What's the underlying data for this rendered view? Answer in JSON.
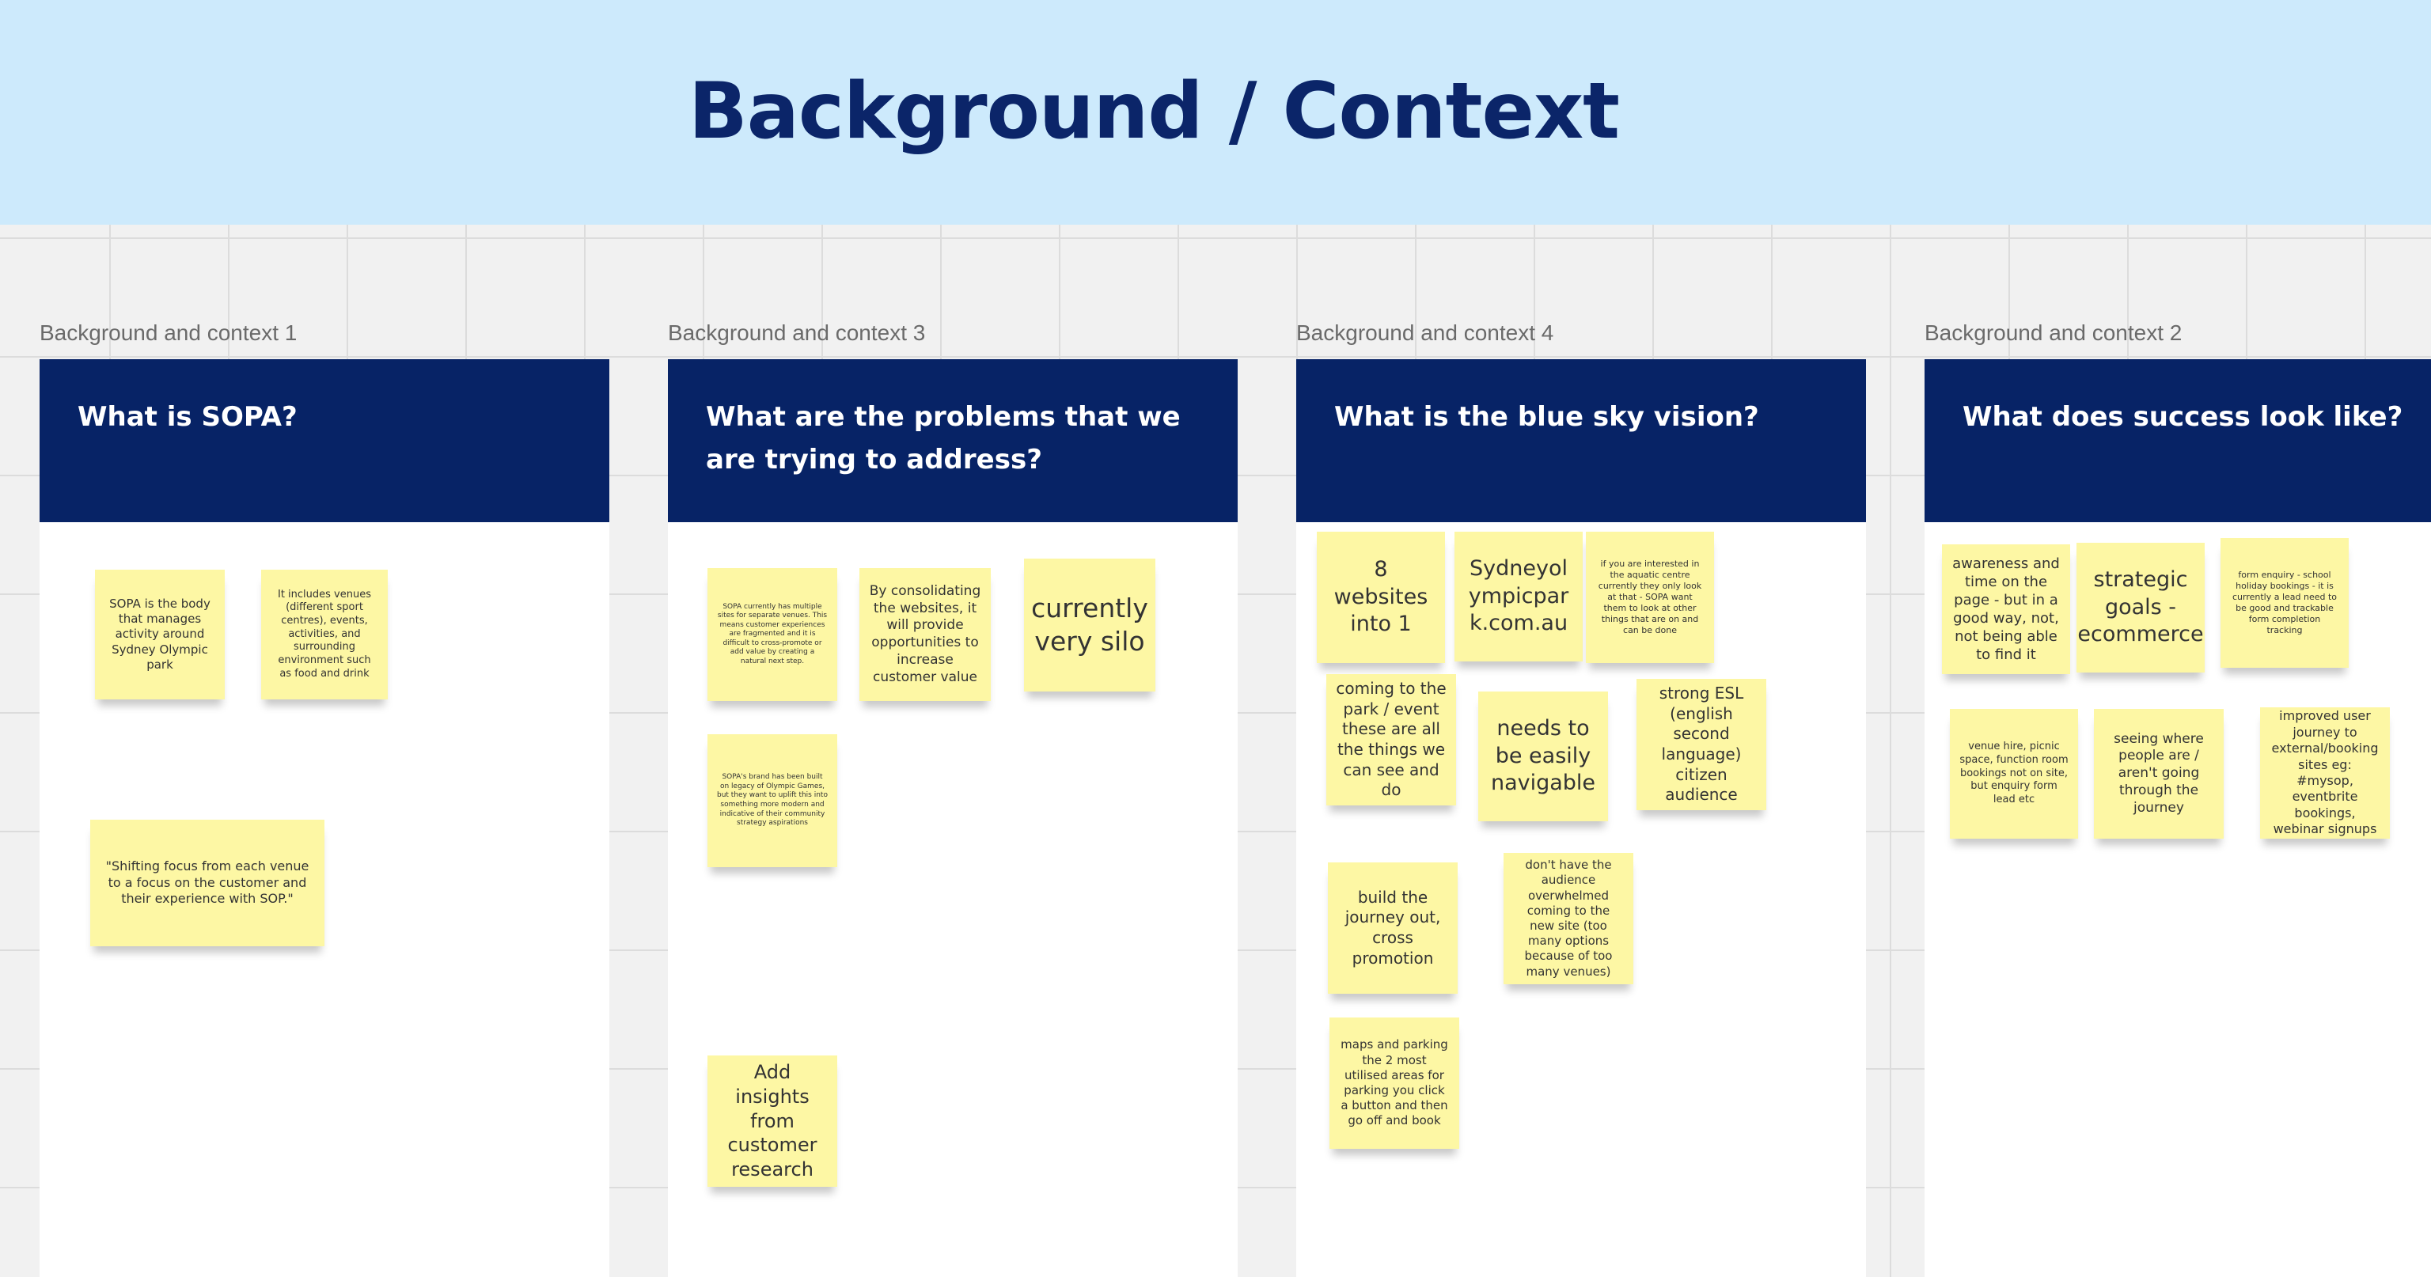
{
  "board": {
    "title": "Background / Context",
    "note_color": "#fdf7a4",
    "banner_color": "#cdeafc",
    "header_color": "#072366"
  },
  "frames": [
    {
      "label": "Background and context 1",
      "title": "What is SOPA?",
      "notes": [
        "SOPA is the body that manages activity around Sydney Olympic park",
        "It includes venues (different sport centres), events, activities, and surrounding environment such as food and drink",
        "\"Shifting focus from each venue to a focus on the customer and their experience with SOP.\""
      ]
    },
    {
      "label": "Background and context 3",
      "title": "What are the problems that we are trying to address?",
      "notes": [
        "SOPA currently has multiple sites for separate venues. This means customer experiences are fragmented and it is difficult to cross-promote or add value by creating a natural next step.",
        "By consolidating the websites, it will provide opportunities to increase customer value",
        "currently very silo",
        "SOPA's brand has been built on legacy of Olympic Games, but they want to uplift this into something more modern and indicative of their community strategy aspirations",
        "Add insights from customer research"
      ]
    },
    {
      "label": "Background and context 4",
      "title": "What is the blue sky vision?",
      "notes": [
        "8 websites into 1",
        "Sydneyolympicpark.com.au",
        "if you are interested in the aquatic centre currently they only look at that - SOPA want them to look at other things that are on and can be done",
        "coming to the park / event these are all the things we can see and do",
        "needs to be easily navigable",
        "strong ESL (english second language) citizen audience",
        "build the journey out, cross promotion",
        "don't have the audience overwhelmed coming to the new site (too many options because of too many venues)",
        "maps and parking the 2 most utilised areas for parking you click a button and then go off and book"
      ]
    },
    {
      "label": "Background and context 2",
      "title": "What does success look like?",
      "notes": [
        "awareness and time on the page - but in a good way, not, not being able to find it",
        "strategic goals - ecommerce",
        "form enquiry - school holiday bookings - it is currently a lead need to be good and trackable form completion tracking",
        "venue hire, picnic space, function room bookings not on site, but enquiry form lead etc",
        "seeing where people are / aren't going through the journey",
        "improved user journey to external/booking sites eg: #mysop, eventbrite bookings, webinar signups"
      ]
    }
  ]
}
